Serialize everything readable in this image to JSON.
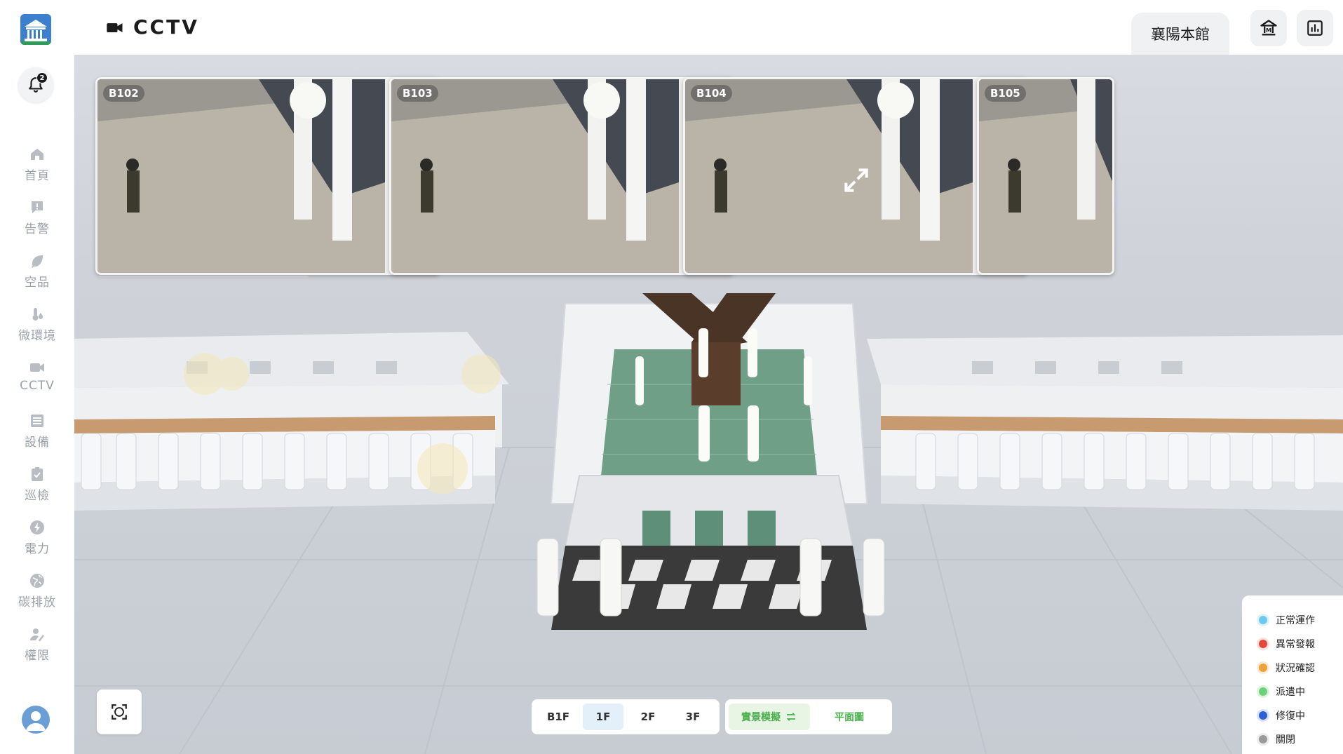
{
  "app": {
    "page_title": "CCTV",
    "venue": "襄陽本館",
    "notification_count": "2"
  },
  "sidebar": {
    "items": [
      {
        "label": "首頁",
        "icon": "home-icon"
      },
      {
        "label": "告警",
        "icon": "alert-icon"
      },
      {
        "label": "空品",
        "icon": "leaf-icon"
      },
      {
        "label": "微環境",
        "icon": "thermometer-icon"
      },
      {
        "label": "CCTV",
        "icon": "camera-icon"
      },
      {
        "label": "設備",
        "icon": "list-icon"
      },
      {
        "label": "巡檢",
        "icon": "clipboard-check-icon"
      },
      {
        "label": "電力",
        "icon": "lightning-icon"
      },
      {
        "label": "碳排放",
        "icon": "globe-icon"
      },
      {
        "label": "權限",
        "icon": "user-key-icon"
      }
    ]
  },
  "cameras": [
    {
      "label": "B102",
      "closable": false
    },
    {
      "label": "B103",
      "closable": false
    },
    {
      "label": "B104",
      "closable": true
    },
    {
      "label": "B105",
      "closable": false
    }
  ],
  "floors": {
    "items": [
      "B1F",
      "1F",
      "2F",
      "3F"
    ],
    "active": "1F"
  },
  "view_modes": {
    "realistic": "實景模擬",
    "floorplan": "平面圖"
  },
  "legend": {
    "items": [
      {
        "label": "正常運作",
        "color": "#6cc8ee"
      },
      {
        "label": "異常發報",
        "color": "#e24a3a"
      },
      {
        "label": "狀況確認",
        "color": "#f0a23a"
      },
      {
        "label": "派遣中",
        "color": "#6fd07a"
      },
      {
        "label": "修復中",
        "color": "#2f5ed6"
      },
      {
        "label": "關閉",
        "color": "#9a9a9a"
      }
    ]
  },
  "colors": {
    "accent_green": "#4bb04e",
    "active_floor_bg": "#e3f0f9"
  }
}
